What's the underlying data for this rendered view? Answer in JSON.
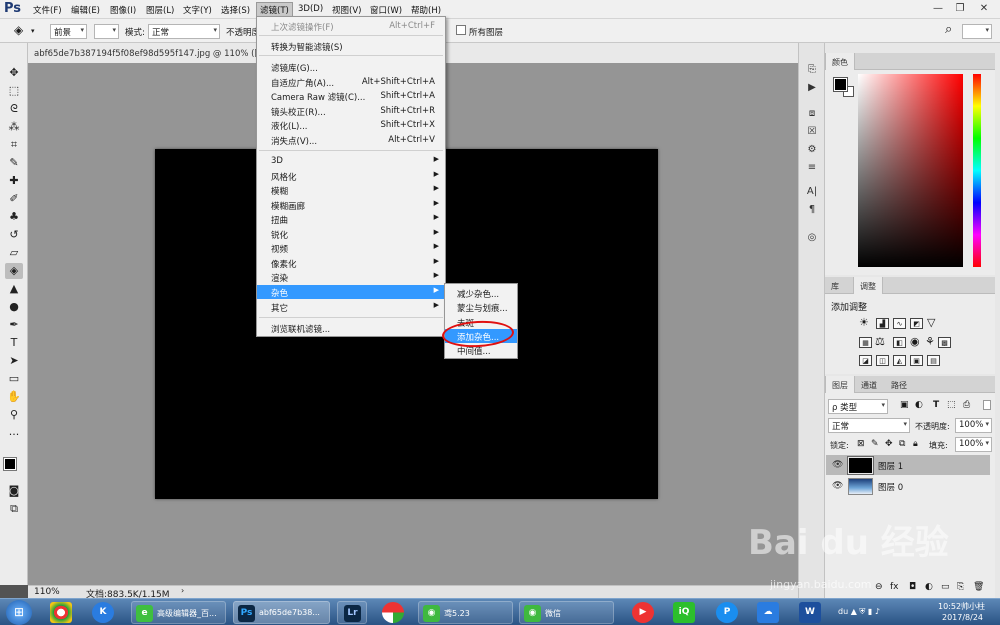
{
  "app": {
    "logo": "Ps"
  },
  "menubar": {
    "items": [
      "文件(F)",
      "编辑(E)",
      "图像(I)",
      "图层(L)",
      "文字(Y)",
      "选择(S)",
      "滤镜(T)",
      "3D(D)",
      "视图(V)",
      "窗口(W)",
      "帮助(H)"
    ],
    "active": "滤镜(T)",
    "win_min": "—",
    "win_max": "❐",
    "win_close": "✕"
  },
  "options": {
    "fill_source": "前景",
    "mode_label": "模式:",
    "mode_value": "正常",
    "opacity_label": "不透明度",
    "all_layers_label": "所有图层",
    "search_icon": "search-icon"
  },
  "document": {
    "tab_title": "abf65de7b387194f5f08ef98d595f147.jpg @ 110% (图层 1, ..."
  },
  "status": {
    "zoom": "110%",
    "doc_info": "文档:883.5K/1.15M"
  },
  "filter_menu": {
    "items": [
      {
        "label": "上次滤镜操作(F)",
        "shortcut": "Alt+Ctrl+F",
        "disabled": true
      },
      {
        "label": "转换为智能滤镜(S)",
        "shortcut": ""
      },
      {
        "label": "滤镜库(G)...",
        "shortcut": ""
      },
      {
        "label": "自适应广角(A)...",
        "shortcut": "Alt+Shift+Ctrl+A"
      },
      {
        "label": "Camera Raw 滤镜(C)...",
        "shortcut": "Shift+Ctrl+A"
      },
      {
        "label": "镜头校正(R)...",
        "shortcut": "Shift+Ctrl+R"
      },
      {
        "label": "液化(L)...",
        "shortcut": "Shift+Ctrl+X"
      },
      {
        "label": "消失点(V)...",
        "shortcut": "Alt+Ctrl+V"
      },
      {
        "label": "3D",
        "submenu": true
      },
      {
        "label": "风格化",
        "submenu": true
      },
      {
        "label": "模糊",
        "submenu": true
      },
      {
        "label": "模糊画廊",
        "submenu": true
      },
      {
        "label": "扭曲",
        "submenu": true
      },
      {
        "label": "锐化",
        "submenu": true
      },
      {
        "label": "视频",
        "submenu": true
      },
      {
        "label": "像素化",
        "submenu": true
      },
      {
        "label": "渲染",
        "submenu": true
      },
      {
        "label": "杂色",
        "submenu": true,
        "highlighted": true
      },
      {
        "label": "其它",
        "submenu": true
      },
      {
        "label": "浏览联机滤镜..."
      }
    ]
  },
  "noise_submenu": {
    "items": [
      "减少杂色...",
      "蒙尘与划痕...",
      "去斑",
      "添加杂色...",
      "中间值..."
    ],
    "highlighted": "添加杂色...",
    "highlight_ring_color": "#e01010"
  },
  "color_panel": {
    "tab": "颜色",
    "fg": "#000000",
    "bg": "#ffffff"
  },
  "adjust_panel": {
    "tabs": [
      "库",
      "调整"
    ],
    "title": "添加调整"
  },
  "layers_panel": {
    "tabs": [
      "图层",
      "通道",
      "路径"
    ],
    "filter_label": "ρ 类型",
    "blend_mode": "正常",
    "opacity_label": "不透明度:",
    "opacity": "100%",
    "lock_label": "锁定:",
    "fill_label": "填充:",
    "fill": "100%",
    "layers": [
      {
        "name": "图层 1",
        "selected": true
      },
      {
        "name": "图层 0",
        "selected": false
      }
    ]
  },
  "taskbar": {
    "items": [
      {
        "label": "高级编辑器_百...",
        "icon": "e"
      },
      {
        "label": "abf65de7b38...",
        "icon": "Ps"
      },
      {
        "label": "",
        "icon": "Lr"
      },
      {
        "label": "鸢5.23",
        "icon": "W"
      },
      {
        "label": "微信",
        "icon": "W"
      }
    ],
    "time": "10:52帅小柱",
    "date": "2017/8/24"
  },
  "watermark": {
    "text": "Bai du 经验",
    "url": "jingyan.baidu.com"
  }
}
